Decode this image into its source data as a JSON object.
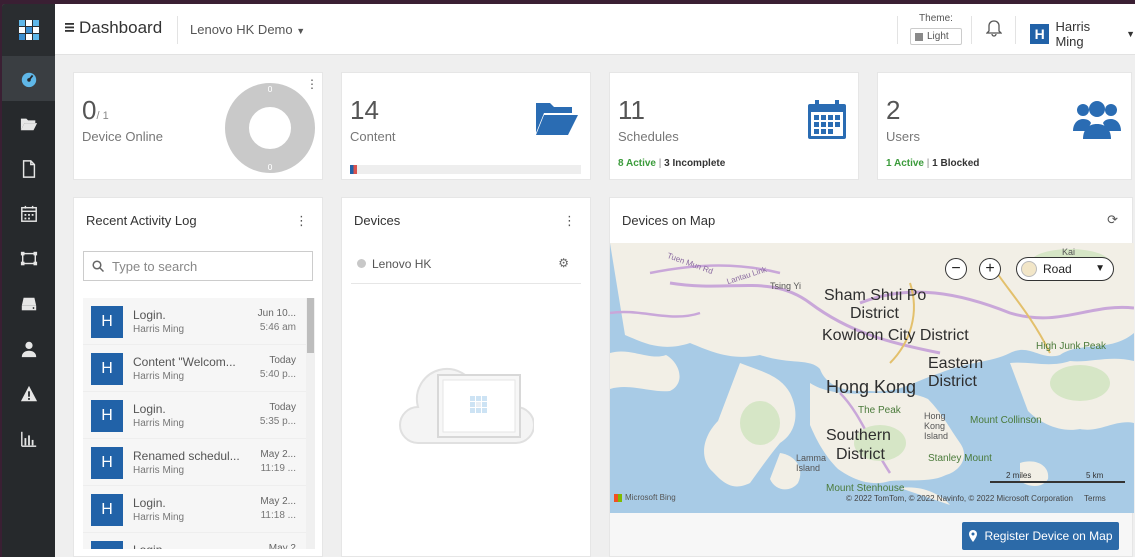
{
  "header": {
    "title": "Dashboard",
    "org": "Lenovo HK Demo",
    "theme_label": "Theme:",
    "theme_value": "Light",
    "user_initial": "H",
    "user_name": "Harris Ming"
  },
  "stats": {
    "devices": {
      "count": "0",
      "total": "/ 1",
      "label": "Device Online"
    },
    "content": {
      "count": "14",
      "label": "Content",
      "progress": 0.03
    },
    "schedules": {
      "count": "11",
      "label": "Schedules",
      "active": "8 Active",
      "separator": "|",
      "incomplete": "3 Incomplete"
    },
    "users": {
      "count": "2",
      "label": "Users",
      "active": "1 Active",
      "separator": "|",
      "blocked": "1 Blocked"
    }
  },
  "activity": {
    "title": "Recent Activity Log",
    "search_placeholder": "Type to search",
    "items": [
      {
        "initial": "H",
        "action": "Login.",
        "user": "Harris Ming",
        "date": "Jun 10...",
        "time": "5:46 am"
      },
      {
        "initial": "H",
        "action": "Content \"Welcom...",
        "user": "Harris Ming",
        "date": "Today",
        "time": "5:40 p..."
      },
      {
        "initial": "H",
        "action": "Login.",
        "user": "Harris Ming",
        "date": "Today",
        "time": "5:35 p..."
      },
      {
        "initial": "H",
        "action": "Renamed schedul...",
        "user": "Harris Ming",
        "date": "May 2...",
        "time": "11:19 ..."
      },
      {
        "initial": "H",
        "action": "Login.",
        "user": "Harris Ming",
        "date": "May 2...",
        "time": "11:18 ..."
      },
      {
        "initial": "H",
        "action": "Login",
        "user": "Harris Ming",
        "date": "May 2",
        "time": ""
      }
    ]
  },
  "devices_panel": {
    "title": "Devices",
    "items": [
      {
        "name": "Lenovo HK"
      }
    ]
  },
  "map_panel": {
    "title": "Devices on Map",
    "map_type": "Road",
    "labels": {
      "sham_shui_po": "Sham Shui Po",
      "district1": "District",
      "kowloon": "Kowloon City District",
      "eastern": "Eastern",
      "hong_kong": "Hong Kong",
      "district2": "District",
      "southern": "Southern",
      "district3": "District",
      "the_peak": "The Peak",
      "hong_kong_island": "Hong\nKong\nIsland",
      "mount_collinson": "Mount Collinson",
      "stanley_mount": "Stanley Mount",
      "high_junk_peak": "High Junk Peak",
      "lamma": "Lamma\nIsland",
      "tsing_yi": "Tsing Yi",
      "mount_stenhouse": "Mount Stenhouse",
      "tuen_mun_rd": "Tuen Mun Rd",
      "lantau_link": "Lantau Link",
      "kai": "Kai"
    },
    "scale_miles": "2 miles",
    "scale_km": "5 km",
    "provider": "Microsoft Bing",
    "copyright": "© 2022 TomTom, © 2022 Navinfo, © 2022 Microsoft Corporation",
    "terms": "Terms",
    "register_label": "Register Device on Map"
  },
  "colors": {
    "accent": "#2162a8",
    "active_green": "#3b9b3b",
    "sidebar": "#26292c"
  }
}
